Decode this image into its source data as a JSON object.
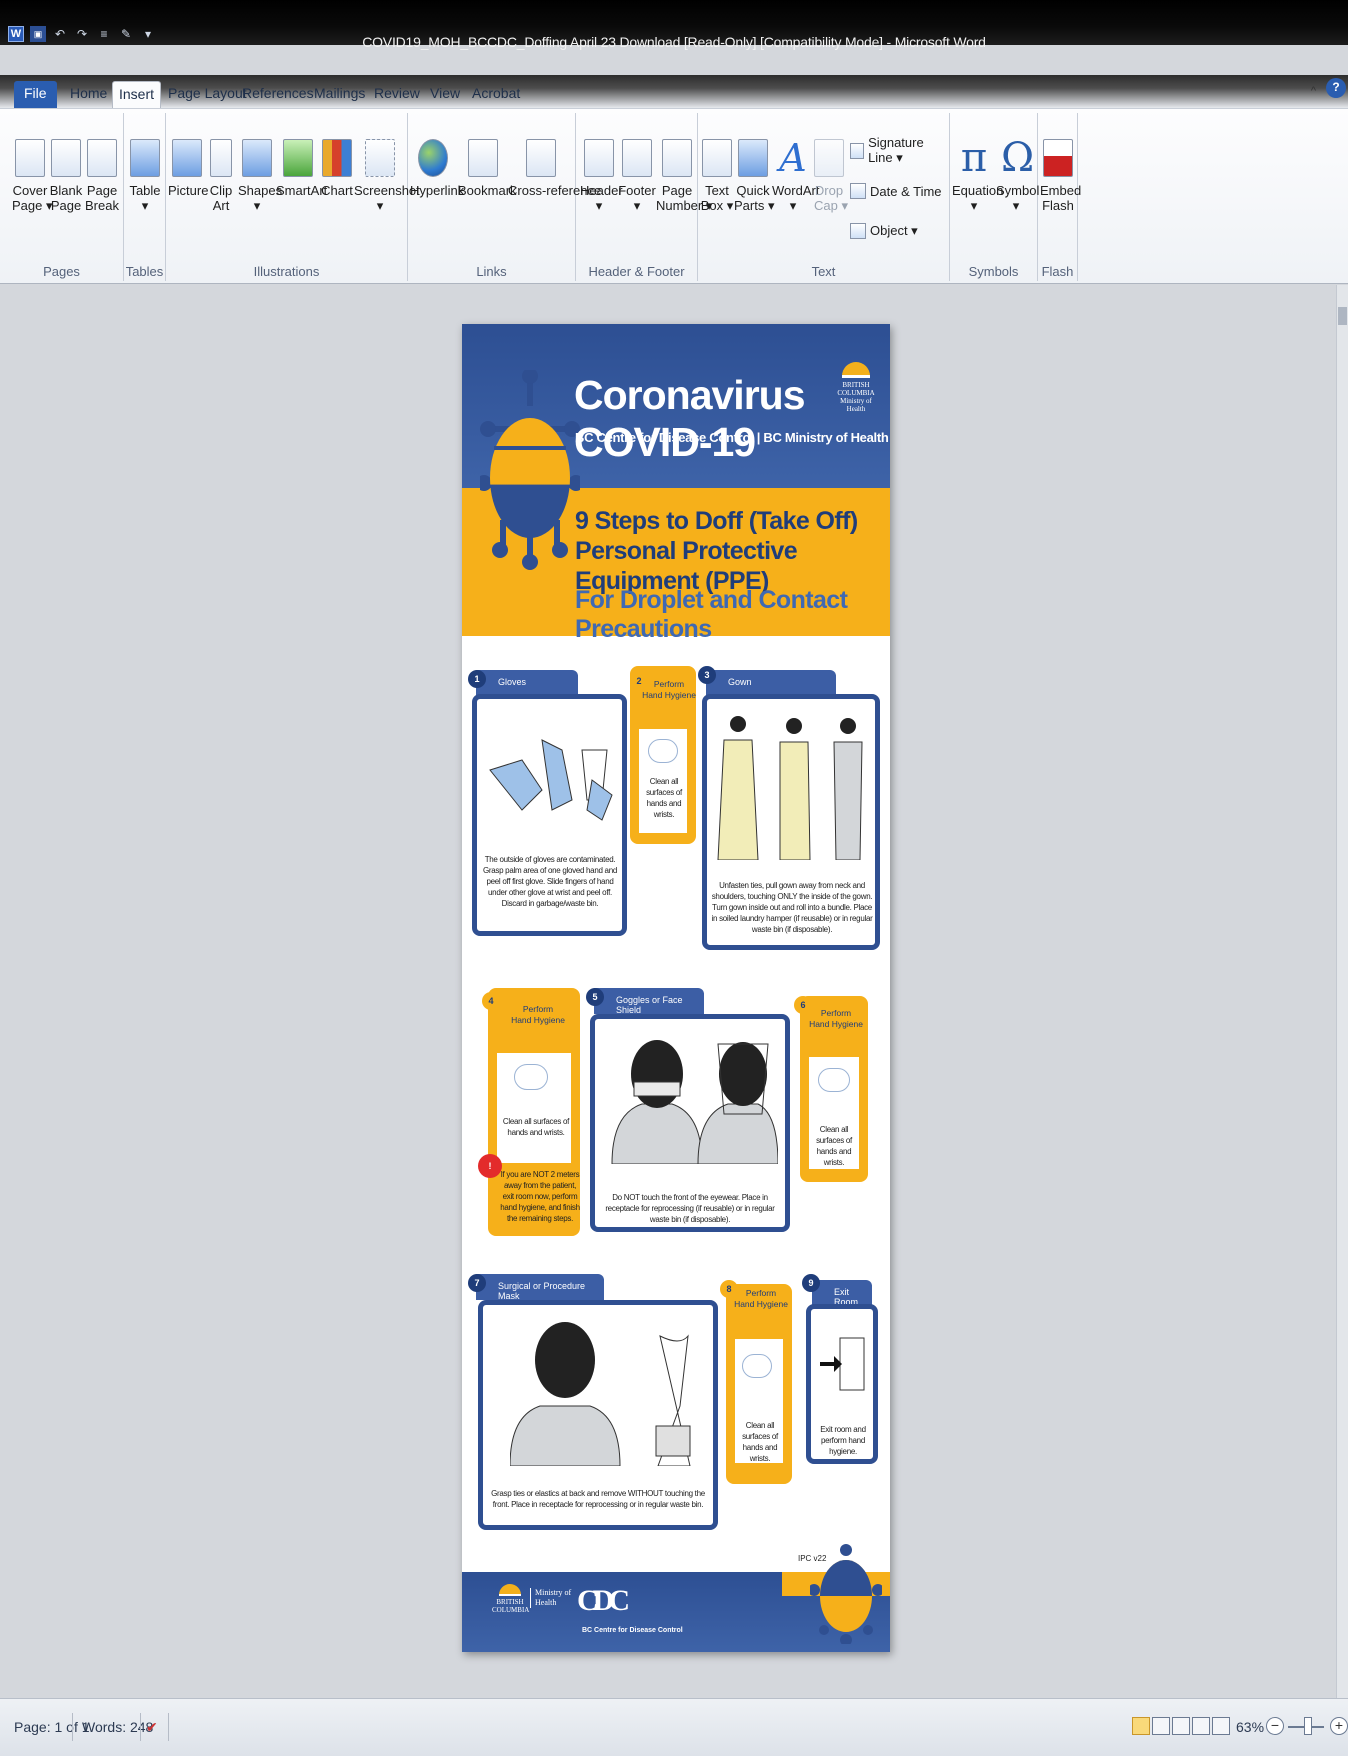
{
  "window": {
    "title": "COVID19_MOH_BCCDC_Doffing April 23 Download [Read-Only] [Compatibility Mode]  -  Microsoft Word",
    "app_icon": "word-icon",
    "quick_access": [
      "save-icon",
      "undo-icon",
      "redo-icon",
      "bullets-icon",
      "format-painter-icon",
      "customize-icon"
    ]
  },
  "tabs": [
    "File",
    "Home",
    "Insert",
    "Page Layout",
    "References",
    "Mailings",
    "Review",
    "View",
    "Acrobat"
  ],
  "active_tab": "Insert",
  "ribbon": {
    "pages": {
      "label": "Pages",
      "cover": "Cover\nPage ▾",
      "blank": "Blank\nPage",
      "break": "Page\nBreak"
    },
    "tables": {
      "label": "Tables",
      "table": "Table\n▾"
    },
    "illustrations": {
      "label": "Illustrations",
      "picture": "Picture",
      "clipart": "Clip\nArt",
      "shapes": "Shapes\n▾",
      "smartart": "SmartArt",
      "chart": "Chart",
      "screenshot": "Screenshot\n▾"
    },
    "links": {
      "label": "Links",
      "hyperlink": "Hyperlink",
      "bookmark": "Bookmark",
      "crossref": "Cross-reference"
    },
    "header_footer": {
      "label": "Header & Footer",
      "header": "Header\n▾",
      "footer": "Footer\n▾",
      "page_number": "Page\nNumber ▾"
    },
    "text": {
      "label": "Text",
      "textbox": "Text\nBox ▾",
      "quickparts": "Quick\nParts ▾",
      "wordart": "WordArt\n▾",
      "dropcap": "Drop\nCap ▾",
      "signature": "Signature Line ▾",
      "datetime": "Date & Time",
      "object": "Object ▾"
    },
    "symbols": {
      "label": "Symbols",
      "equation": "Equation\n▾",
      "symbol": "Symbol\n▾"
    },
    "flash": {
      "label": "Flash",
      "embed": "Embed\nFlash"
    }
  },
  "poster": {
    "title": "Coronavirus COVID-19",
    "subtitle": "BC Centre for Disease Control | BC Ministry of Health",
    "bc_logo_text": "BRITISH\nCOLUMBIA\nMinistry of\nHealth",
    "heading_1": "9 Steps to Doff (Take Off)",
    "heading_2": "Personal Protective Equipment (PPE)",
    "heading_3": "For Droplet and Contact Precautions",
    "steps": [
      {
        "num": "1",
        "title": "Gloves",
        "text": "The outside of gloves are contaminated. Grasp palm area of one gloved hand and peel off first glove. Slide fingers of hand under other glove at wrist and peel off. Discard in garbage/waste bin."
      },
      {
        "num": "2",
        "title": "Perform\nHand Hygiene",
        "text": "Clean all surfaces of hands and wrists."
      },
      {
        "num": "3",
        "title": "Gown",
        "text": "Unfasten ties, pull gown away from neck and shoulders, touching ONLY the inside of the gown. Turn gown inside out and roll into a bundle. Place in soiled laundry hamper (if reusable) or in regular waste bin (if disposable)."
      },
      {
        "num": "4",
        "title": "Perform\nHand Hygiene",
        "text": "Clean all surfaces of hands and wrists.",
        "alert": "If you are NOT 2 meters away from the patient, exit room now, perform hand hygiene, and finish the remaining steps."
      },
      {
        "num": "5",
        "title": "Goggles or Face Shield",
        "text": "Do NOT touch the front of the eyewear. Place in receptacle for reprocessing (if reusable) or in regular waste bin (if disposable)."
      },
      {
        "num": "6",
        "title": "Perform\nHand Hygiene",
        "text": "Clean all surfaces of hands and wrists."
      },
      {
        "num": "7",
        "title": "Surgical or Procedure Mask",
        "text": "Grasp ties or elastics at back and remove WITHOUT touching the front. Place in receptacle for reprocessing or in regular waste bin."
      },
      {
        "num": "8",
        "title": "Perform\nHand Hygiene",
        "text": "Clean all surfaces of hands and wrists."
      },
      {
        "num": "9",
        "title": "Exit Room",
        "text": "Exit room and perform hand hygiene."
      }
    ],
    "alert_mark": "!",
    "ipc": "IPC v22",
    "footer_bc": "BRITISH\nCOLUMBIA",
    "footer_ministry": "Ministry of\nHealth",
    "footer_bccdc_logo": "CDC",
    "footer_bccdc": "BC Centre for Disease Control"
  },
  "status": {
    "page": "Page: 1 of 1",
    "words": "Words: 248",
    "zoom": "63%"
  },
  "colors": {
    "navy": "#2f4f91",
    "yellow": "#f6b01a",
    "ribbon_blue": "#2a5db0"
  }
}
